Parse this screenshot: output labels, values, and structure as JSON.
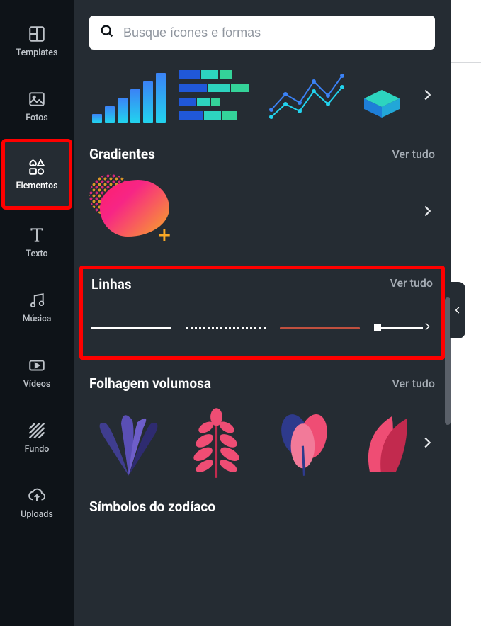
{
  "sidebar": {
    "items": [
      {
        "label": "Templates"
      },
      {
        "label": "Fotos"
      },
      {
        "label": "Elementos"
      },
      {
        "label": "Texto"
      },
      {
        "label": "Música"
      },
      {
        "label": "Vídeos"
      },
      {
        "label": "Fundo"
      },
      {
        "label": "Uploads"
      }
    ]
  },
  "search": {
    "placeholder": "Busque ícones e formas"
  },
  "sections": {
    "charts": {
      "see_all": ""
    },
    "gradients": {
      "title": "Gradientes",
      "see_all": "Ver tudo"
    },
    "lines": {
      "title": "Linhas",
      "see_all": "Ver tudo"
    },
    "foliage": {
      "title": "Folhagem volumosa",
      "see_all": "Ver tudo"
    },
    "zodiac": {
      "title": "Símbolos do zodíaco"
    }
  }
}
